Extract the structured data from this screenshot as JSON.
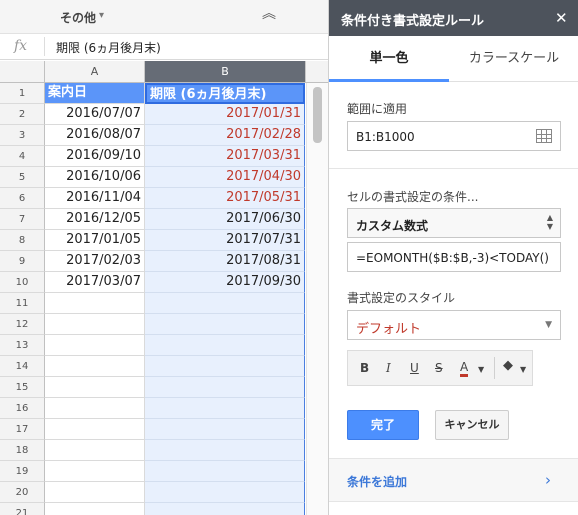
{
  "toolbar": {
    "menu_label": "その他",
    "menu_caret": "▾",
    "collapse_icon": "︽"
  },
  "formula_bar": {
    "fx": "fx",
    "value": "期限 (6ヵ月後月末)"
  },
  "columns": [
    "A",
    "B"
  ],
  "rows": [
    {
      "n": "1",
      "a": "案内日",
      "b": "期限 (6ヵ月後月末)",
      "b_red": false,
      "head": true
    },
    {
      "n": "2",
      "a": "2016/07/07",
      "b": "2017/01/31",
      "b_red": true
    },
    {
      "n": "3",
      "a": "2016/08/07",
      "b": "2017/02/28",
      "b_red": true
    },
    {
      "n": "4",
      "a": "2016/09/10",
      "b": "2017/03/31",
      "b_red": true
    },
    {
      "n": "5",
      "a": "2016/10/06",
      "b": "2017/04/30",
      "b_red": true
    },
    {
      "n": "6",
      "a": "2016/11/04",
      "b": "2017/05/31",
      "b_red": true
    },
    {
      "n": "7",
      "a": "2016/12/05",
      "b": "2017/06/30",
      "b_red": false
    },
    {
      "n": "8",
      "a": "2017/01/05",
      "b": "2017/07/31",
      "b_red": false
    },
    {
      "n": "9",
      "a": "2017/02/03",
      "b": "2017/08/31",
      "b_red": false
    },
    {
      "n": "10",
      "a": "2017/03/07",
      "b": "2017/09/30",
      "b_red": false
    },
    {
      "n": "11",
      "a": "",
      "b": "",
      "b_red": false
    },
    {
      "n": "12",
      "a": "",
      "b": "",
      "b_red": false
    },
    {
      "n": "13",
      "a": "",
      "b": "",
      "b_red": false
    },
    {
      "n": "14",
      "a": "",
      "b": "",
      "b_red": false
    },
    {
      "n": "15",
      "a": "",
      "b": "",
      "b_red": false
    },
    {
      "n": "16",
      "a": "",
      "b": "",
      "b_red": false
    },
    {
      "n": "17",
      "a": "",
      "b": "",
      "b_red": false
    },
    {
      "n": "18",
      "a": "",
      "b": "",
      "b_red": false
    },
    {
      "n": "19",
      "a": "",
      "b": "",
      "b_red": false
    },
    {
      "n": "20",
      "a": "",
      "b": "",
      "b_red": false
    },
    {
      "n": "21",
      "a": "",
      "b": "",
      "b_red": false
    }
  ],
  "panel": {
    "title": "条件付き書式設定ルール",
    "close": "✕",
    "tabs": [
      {
        "label": "単一色"
      },
      {
        "label": "カラースケール"
      }
    ],
    "range_label": "範囲に適用",
    "range_value": "B1:B1000",
    "condition_label": "セルの書式設定の条件...",
    "condition_type": "カスタム数式",
    "formula": "=EOMONTH($B:$B,-3)<TODAY()",
    "style_label": "書式設定のスタイル",
    "style_value": "デフォルト",
    "format_buttons": {
      "bold": "B",
      "italic": "I",
      "underline": "U",
      "strike": "S",
      "text_color": "A",
      "fill": "◆"
    },
    "done": "完了",
    "cancel": "キャンセル",
    "add_rule": "条件を追加",
    "add_chev": "›"
  },
  "colors": {
    "accent": "#4d90fe",
    "header_fill": "#5b95f9",
    "selection": "#e8f0fd",
    "highlight_text": "#c0392b",
    "panel_header": "#4d535c"
  }
}
